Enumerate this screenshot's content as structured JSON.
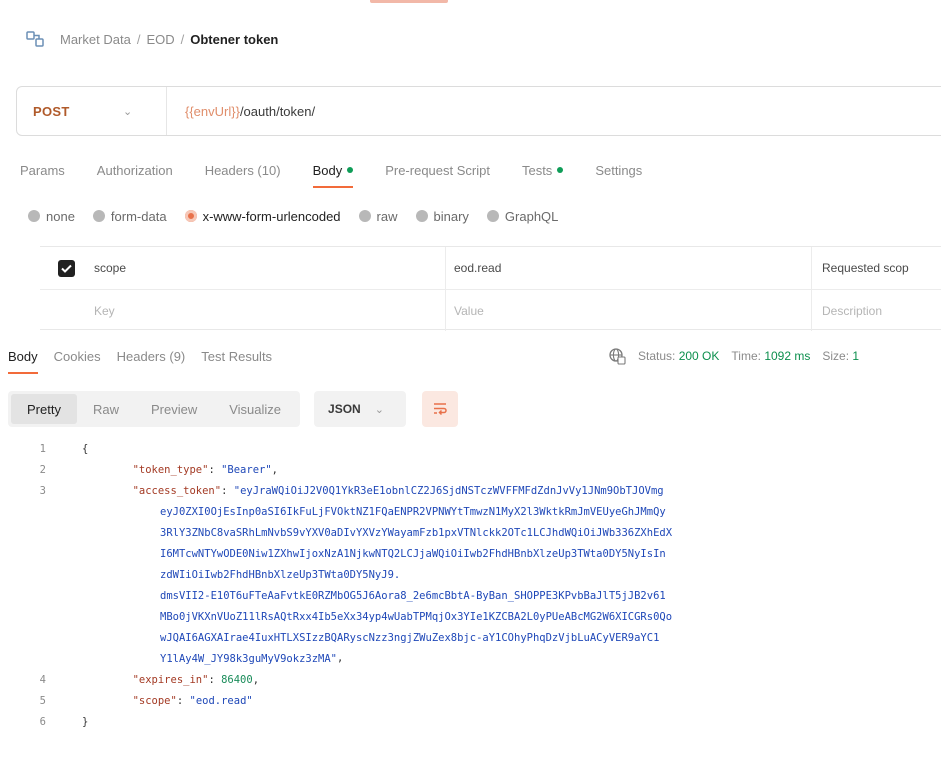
{
  "breadcrumb": {
    "items": [
      "Market Data",
      "EOD"
    ],
    "current": "Obtener token",
    "separator": "/"
  },
  "request": {
    "method": "POST",
    "url_variable": "{{envUrl}}",
    "url_path": "/oauth/token/"
  },
  "request_tabs": [
    {
      "label": "Params",
      "active": false
    },
    {
      "label": "Authorization",
      "active": false
    },
    {
      "label": "Headers (10)",
      "active": false
    },
    {
      "label": "Body",
      "active": true,
      "dot": true
    },
    {
      "label": "Pre-request Script",
      "active": false
    },
    {
      "label": "Tests",
      "active": false,
      "dot": true
    },
    {
      "label": "Settings",
      "active": false
    }
  ],
  "body_types": [
    {
      "label": "none",
      "selected": false
    },
    {
      "label": "form-data",
      "selected": false
    },
    {
      "label": "x-www-form-urlencoded",
      "selected": true
    },
    {
      "label": "raw",
      "selected": false
    },
    {
      "label": "binary",
      "selected": false
    },
    {
      "label": "GraphQL",
      "selected": false
    }
  ],
  "params": {
    "row": {
      "key": "scope",
      "value": "eod.read",
      "description": "Requested scop"
    },
    "placeholder": {
      "key": "Key",
      "value": "Value",
      "description": "Description"
    }
  },
  "response_tabs": [
    {
      "label": "Body",
      "active": true
    },
    {
      "label": "Cookies",
      "active": false
    },
    {
      "label": "Headers (9)",
      "active": false
    },
    {
      "label": "Test Results",
      "active": false
    }
  ],
  "status": {
    "status_label": "Status:",
    "status_value": "200 OK",
    "time_label": "Time:",
    "time_value": "1092 ms",
    "size_label": "Size:",
    "size_value": "1"
  },
  "view_tabs": [
    {
      "label": "Pretty",
      "active": true
    },
    {
      "label": "Raw",
      "active": false
    },
    {
      "label": "Preview",
      "active": false
    },
    {
      "label": "Visualize",
      "active": false
    }
  ],
  "format": "JSON",
  "code": {
    "line_numbers": [
      "1",
      "2",
      "3",
      "4",
      "5",
      "6"
    ],
    "open_brace": "{",
    "close_brace": "}",
    "token_type_key": "\"token_type\"",
    "token_type_value": "\"Bearer\"",
    "access_token_key": "\"access_token\"",
    "access_token_lines": [
      "\"eyJraWQiOiJ2V0Q1YkR3eE1obnlCZ2J6SjdNSTczWVFFMFdZdnJvVy1JNm9ObTJOVmg",
      "eyJ0ZXI0OjEsInp0aSI6IkFuLjFVOktNZ1FQaENPR2VPNWYtTmwzN1MyX2l3WktkRmJmVEUyeGhJMmQy",
      "3RlY3ZNbC8vaSRhLmNvbS9vYXV0aDIvYXVzYWayamFzb1pxVTNlckk2OTc1LCJhdWQiOiJWb336ZXhEdX",
      "I6MTcwNTYwODE0Niw1ZXhwIjoxNzA1NjkwNTQ2LCJjaWQiOiIwb2FhdHBnbXlzeUp3TWta0DY5NyIsIn",
      "zdWIiOiIwb2FhdHBnbXlzeUp3TWta0DY5NyJ9.",
      "dmsVII2-E10T6uFTeAaFvtkE0RZMbOG5J6Aora8_2e6mcBbtA-ByBan_SHOPPE3KPvbBaJlT5jJB2v61",
      "MBo0jVKXnVUoZ11lRsAQtRxx4Ib5eXx34yp4wUabTPMqjOx3YIe1KZCBA2L0yPUeABcMG2W6XICGRs0Qo",
      "wJQAI6AGXAIrae4IuxHTLXSIzzBQARyscNzz3ngjZWuZex8bjc-aY1COhyPhqDzVjbLuACyVER9aYC1",
      "Y1lAy4W_JY98k3guMyV9okz3zMA\""
    ],
    "expires_key": "\"expires_in\"",
    "expires_value": "86400",
    "scope_key": "\"scope\"",
    "scope_value": "\"eod.read\""
  }
}
